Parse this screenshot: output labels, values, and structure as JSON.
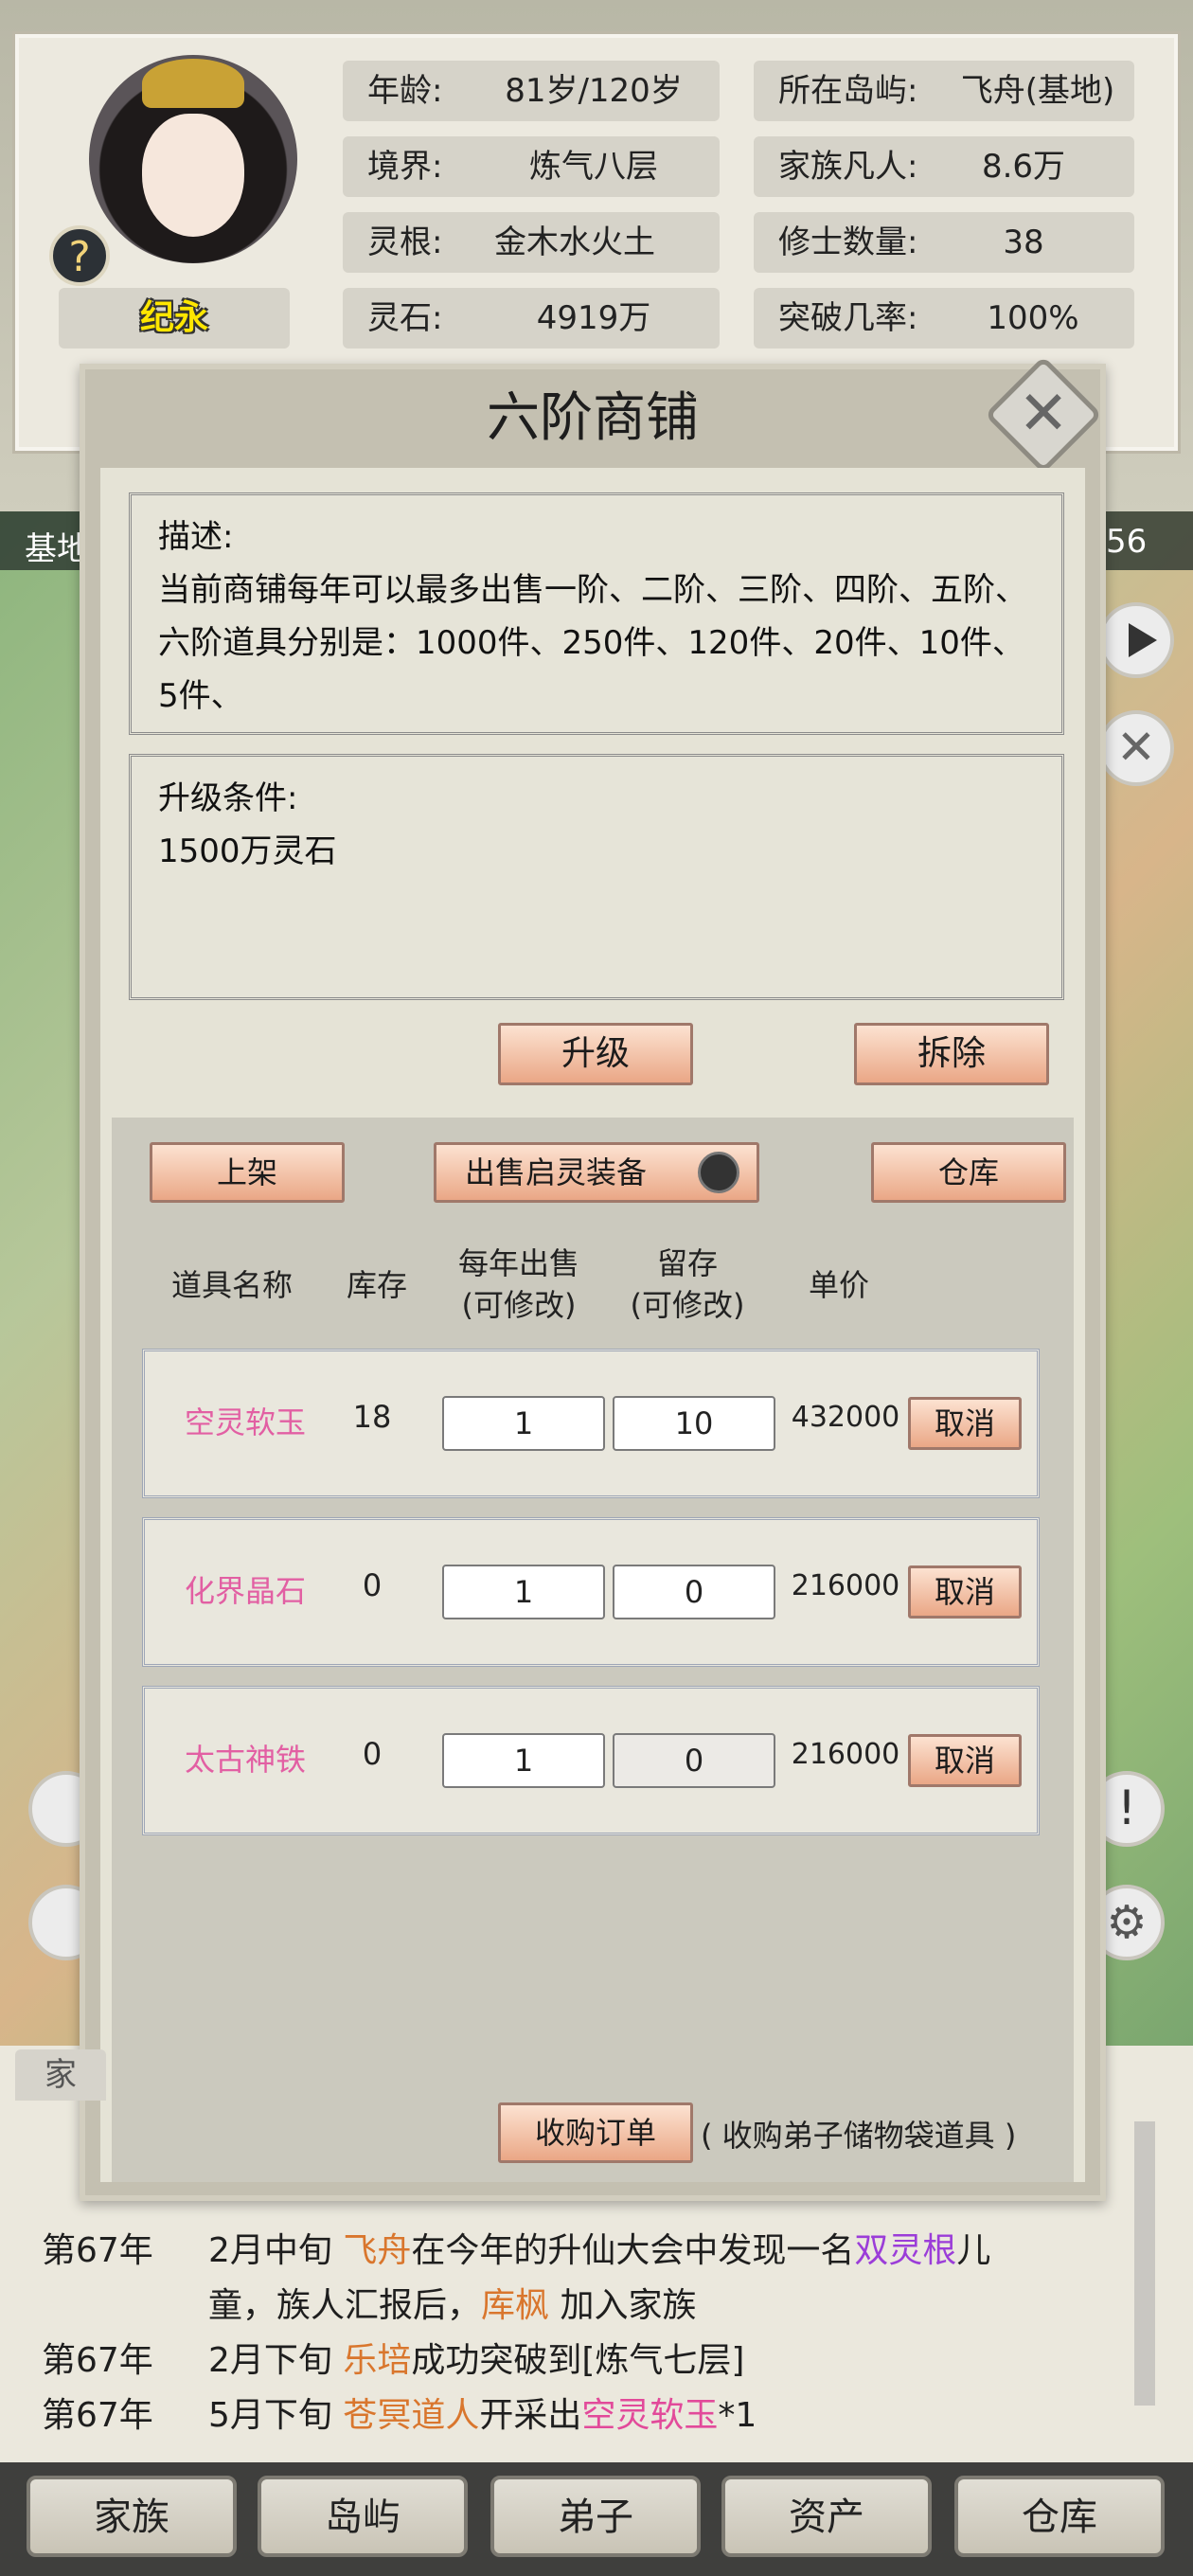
{
  "profile": {
    "name": "纪永",
    "stats": [
      {
        "label": "年龄:",
        "value": "81岁/120岁"
      },
      {
        "label": "所在岛屿:",
        "value": "飞舟(基地)"
      },
      {
        "label": "境界:",
        "value": "炼气八层"
      },
      {
        "label": "家族凡人:",
        "value": "8.6万"
      },
      {
        "label": "灵根:",
        "value": "金木水火土"
      },
      {
        "label": "修士数量:",
        "value": "38"
      },
      {
        "label": "灵石:",
        "value": "4919万"
      },
      {
        "label": "突破几率:",
        "value": "100%"
      }
    ]
  },
  "map": {
    "left_label": "基地",
    "right_label": "56"
  },
  "modal": {
    "title": "六阶商铺",
    "description_title": "描述:",
    "description_text": "当前商铺每年可以最多出售一阶、二阶、三阶、四阶、五阶、六阶道具分别是：1000件、250件、120件、20件、10件、5件、",
    "upgrade_title": "升级条件:",
    "upgrade_text": "1500万灵石",
    "upgrade_button": "升级",
    "demolish_button": "拆除",
    "list_button": "上架",
    "sell_equipment_toggle": "出售启灵装备",
    "warehouse_button": "仓库",
    "columns": {
      "name": "道具名称",
      "stock": "库存",
      "yearly_sale": "每年出售\n(可修改)",
      "reserve": "留存\n(可修改)",
      "price": "单价"
    },
    "items": [
      {
        "name": "空灵软玉",
        "stock": "18",
        "yearly": "1",
        "reserve": "10",
        "price": "432000",
        "cancel": "取消"
      },
      {
        "name": "化界晶石",
        "stock": "0",
        "yearly": "1",
        "reserve": "0",
        "price": "216000",
        "cancel": "取消"
      },
      {
        "name": "太古神铁",
        "stock": "0",
        "yearly": "1",
        "reserve": "0",
        "price": "216000",
        "cancel": "取消"
      }
    ],
    "purchase_button": "收购订单",
    "purchase_note": "( 收购弟子储物袋道具 )"
  },
  "log": {
    "tab_label": "家",
    "entries": [
      {
        "year": "第67年",
        "parts": [
          {
            "t": "2月中旬 ",
            "c": ""
          },
          {
            "t": "飞舟",
            "c": "orange"
          },
          {
            "t": "在今年的升仙大会中发现一名",
            "c": ""
          },
          {
            "t": "双灵根",
            "c": "purple"
          },
          {
            "t": "儿",
            "c": ""
          }
        ]
      },
      {
        "year": "",
        "parts": [
          {
            "t": "童，族人汇报后，",
            "c": ""
          },
          {
            "t": "库枫",
            "c": "orange"
          },
          {
            "t": " 加入家族",
            "c": ""
          }
        ]
      },
      {
        "year": "第67年",
        "parts": [
          {
            "t": "2月下旬 ",
            "c": ""
          },
          {
            "t": "乐培",
            "c": "orange"
          },
          {
            "t": "成功突破到[炼气七层]",
            "c": ""
          }
        ]
      },
      {
        "year": "第67年",
        "parts": [
          {
            "t": "5月下旬 ",
            "c": ""
          },
          {
            "t": "苍冥道人",
            "c": "orange"
          },
          {
            "t": "开采出",
            "c": ""
          },
          {
            "t": "空灵软玉",
            "c": "pink"
          },
          {
            "t": "*1",
            "c": ""
          }
        ]
      }
    ]
  },
  "nav": [
    "家族",
    "岛屿",
    "弟子",
    "资产",
    "仓库"
  ]
}
